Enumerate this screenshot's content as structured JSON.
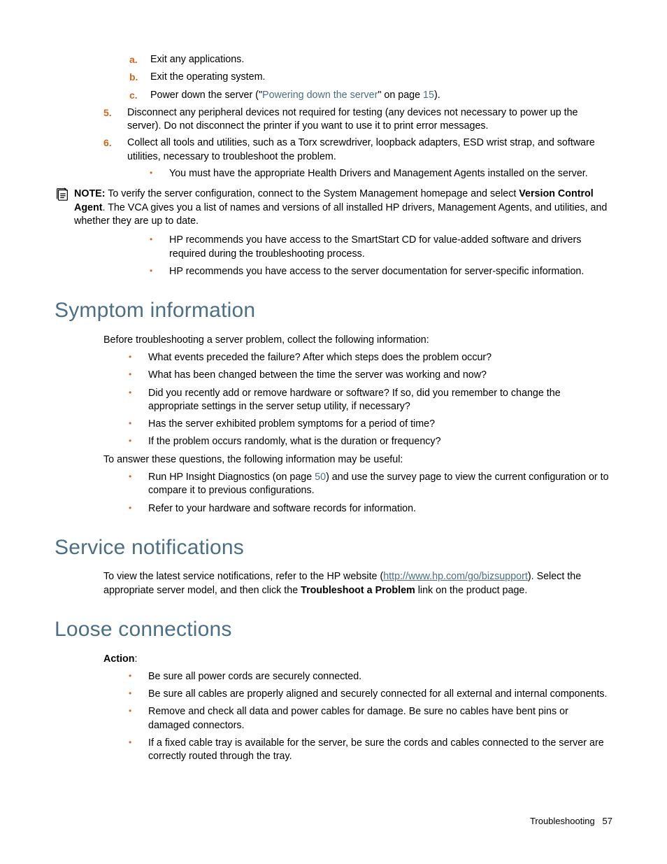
{
  "steps_abc": {
    "a": "Exit any applications.",
    "b": "Exit the operating system.",
    "c_pre": "Power down the server (\"",
    "c_link": "Powering down the server",
    "c_mid": "\" on page ",
    "c_page": "15",
    "c_post": ")."
  },
  "steps_num": {
    "n5": "Disconnect any peripheral devices not required for testing (any devices not necessary to power up the server). Do not disconnect the printer if you want to use it to print error messages.",
    "n6": "Collect all tools and utilities, such as a Torx screwdriver, loopback adapters, ESD wrist strap, and software utilities, necessary to troubleshoot the problem.",
    "n6_sub": "You must have the appropriate Health Drivers and Management Agents installed on the server."
  },
  "note": {
    "label": "NOTE:",
    "t1": " To verify the server configuration, connect to the System Management homepage and select ",
    "bold1": "Version Control Agent",
    "t2": ". The VCA gives you a list of names and versions of all installed HP drivers, Management Agents, and utilities, and whether they are up to date."
  },
  "after_note_bullets": {
    "b1": "HP recommends you have access to the SmartStart CD for value-added software and drivers required during the troubleshooting process.",
    "b2": "HP recommends you have access to the server documentation for server-specific information."
  },
  "symptom": {
    "heading": "Symptom information",
    "intro": "Before troubleshooting a server problem, collect the following information:",
    "b1": "What events preceded the failure? After which steps does the problem occur?",
    "b2": "What has been changed between the time the server was working and now?",
    "b3": "Did you recently add or remove hardware or software? If so, did you remember to change the appropriate settings in the server setup utility, if necessary?",
    "b4": "Has the server exhibited problem symptoms for a period of time?",
    "b5": "If the problem occurs randomly, what is the duration or frequency?",
    "p2": "To answer these questions, the following information may be useful:",
    "b6_pre": "Run HP Insight Diagnostics (on page ",
    "b6_page": "50",
    "b6_post": ") and use the survey page to view the current configuration or to compare it to previous configurations.",
    "b7": "Refer to your hardware and software records for information."
  },
  "service": {
    "heading": "Service notifications",
    "p_pre": "To view the latest service notifications, refer to the HP website (",
    "p_link": "http://www.hp.com/go/bizsupport",
    "p_mid": "). Select the appropriate server model, and then click the ",
    "p_bold": "Troubleshoot a Problem",
    "p_post": " link on the product page."
  },
  "loose": {
    "heading": "Loose connections",
    "action_label": "Action",
    "b1": "Be sure all power cords are securely connected.",
    "b2": "Be sure all cables are properly aligned and securely connected for all external and internal components.",
    "b3": "Remove and check all data and power cables for damage. Be sure no cables have bent pins or damaged connectors.",
    "b4": "If a fixed cable tray is available for the server, be sure the cords and cables connected to the server are correctly routed through the tray."
  },
  "footer": {
    "section": "Troubleshooting",
    "page": "57"
  }
}
